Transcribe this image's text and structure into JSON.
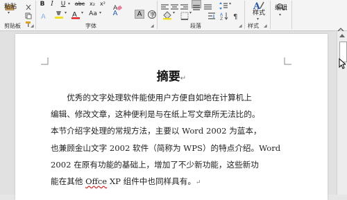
{
  "ribbon": {
    "clipboard": {
      "paste_label": "粘贴",
      "group_label": "剪贴板"
    },
    "font": {
      "group_label": "字体",
      "bold": "B",
      "italic": "I",
      "underline": "U",
      "strikethrough": "abc",
      "subscript": "x₂",
      "superscript": "x²",
      "font_color": "A",
      "clear_format": "Aa",
      "phonetic": "A",
      "char_border": "A"
    },
    "paragraph": {
      "group_label": "段落"
    },
    "styles": {
      "group_label": "样式",
      "styles_label": "样式"
    },
    "editing": {
      "label": "编辑"
    }
  },
  "document": {
    "title": "摘要",
    "paragraph_mark": "↵",
    "body_lines": [
      "　　优秀的文字处理软件能使用户方便自如地在计算机上",
      "编辑、修改文章，这种便利是与在纸上写文章所无法比的。",
      "本节介绍字处理的常规方法，主要以 Word 2002 为蓝本，",
      "也兼顾金山文字 2002 软件（简称为 WPS）的特点介绍。Word",
      "2002 在原有功能的基础上，增加了不少新功能，这些新功",
      "能在其他 "
    ],
    "last_line_error_word": "Offce",
    "last_line_tail": " XP 组件中也同样具有。",
    "last_line_mark": "↵"
  },
  "colors": {
    "font_color_bar": "#e02020",
    "highlight_bar": "#f0e020",
    "accent": "#2b579a"
  }
}
